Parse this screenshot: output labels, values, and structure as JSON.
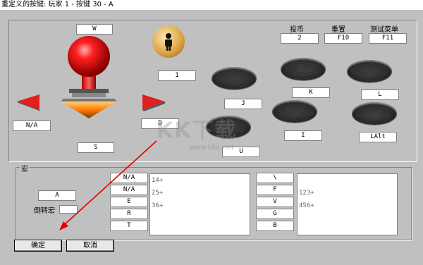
{
  "window": {
    "title": "重定义的按键: 玩家 1 - 按键 30 - A"
  },
  "joystick": {
    "up": "W",
    "down": "S",
    "left": "N/A",
    "right": "D",
    "button1": "1"
  },
  "top_buttons": [
    {
      "title": "投币",
      "value": "2"
    },
    {
      "title": "重置",
      "value": "F10"
    },
    {
      "title": "测试菜单",
      "value": "F11"
    }
  ],
  "action_buttons": [
    {
      "label": "J"
    },
    {
      "label": "K"
    },
    {
      "label": "L"
    },
    {
      "label": "U"
    },
    {
      "label": "I"
    },
    {
      "label": "LAlt"
    }
  ],
  "macro": {
    "group_label": "宏",
    "key_value": "A",
    "reverse_label": "倒转宏",
    "left_keys": [
      "N/A",
      "N/A",
      "E",
      "R",
      "T"
    ],
    "left_sequences": [
      "14+",
      "25+",
      "36+"
    ],
    "right_keys": [
      "\\",
      "F",
      "V",
      "G",
      "B"
    ],
    "right_sequences": [
      "",
      "123+",
      "456+"
    ]
  },
  "footer": {
    "ok_label": "确定",
    "cancel_label": "取消"
  },
  "watermark": {
    "text": "KK下载",
    "url": "www.kkx.net"
  },
  "colors": {
    "ball": "#e01010",
    "arrow": "#e02020",
    "arrow_line": "#e00000",
    "oval": "#2a2a2a"
  }
}
